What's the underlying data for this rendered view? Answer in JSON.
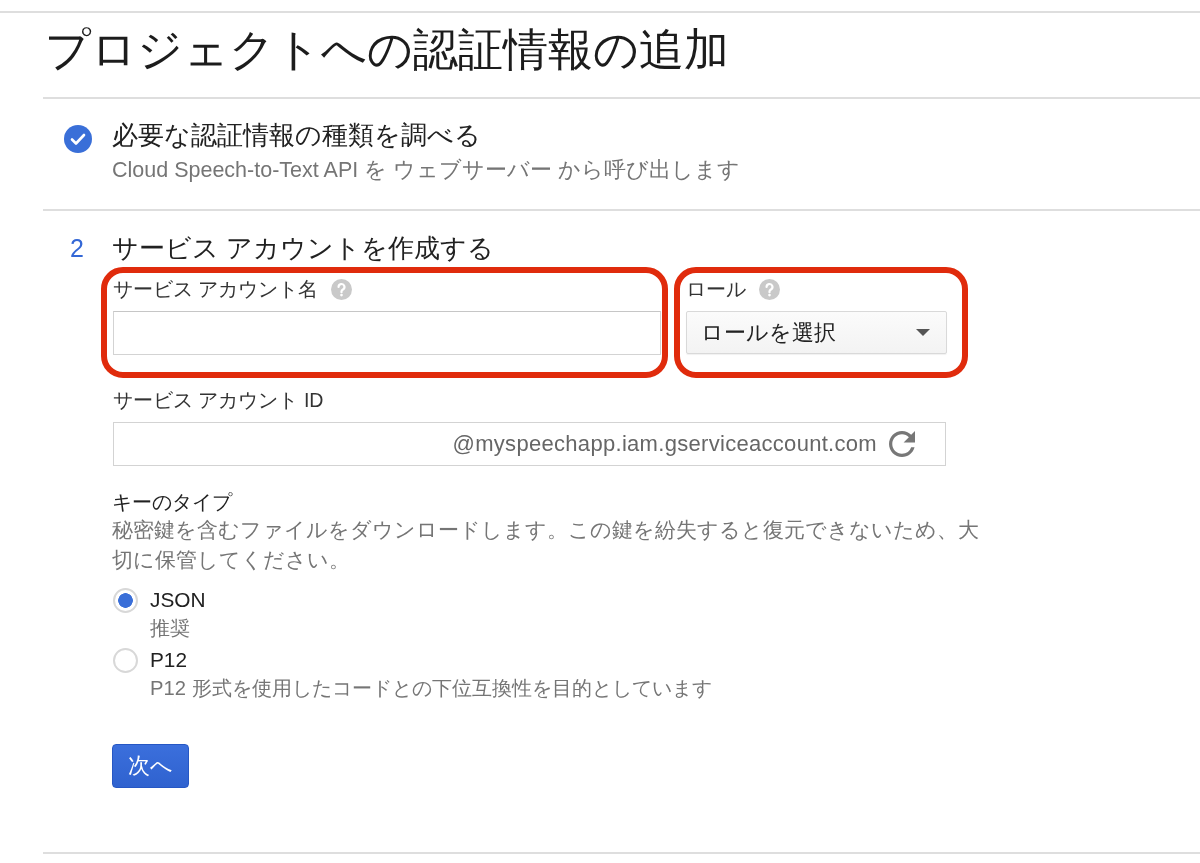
{
  "page_title": "プロジェクトへの認証情報の追加",
  "steps": [
    {
      "kind": "done",
      "title": "必要な認証情報の種類を調べる",
      "description": "Cloud Speech-to-Text API を ウェブサーバー から呼び出します"
    },
    {
      "kind": "numbered",
      "number": "2",
      "title": "サービス アカウントを作成する",
      "fields": [
        {
          "kind": "text",
          "label": "サービス アカウント名",
          "help": true,
          "highlighted": true
        },
        {
          "kind": "select",
          "label": "ロール",
          "help": true,
          "value": "ロールを選択",
          "highlighted": true
        },
        {
          "kind": "suffixed",
          "label": "サービス アカウント ID",
          "help": false,
          "suffix": "@myspeechapp.iam.gserviceaccount.com",
          "highlighted": false
        }
      ],
      "key_type": {
        "label": "キーのタイプ",
        "description": "秘密鍵を含むファイルをダウンロードします。この鍵を紛失すると復元できないため、大切に保管してください。",
        "options": [
          {
            "label": "JSON",
            "note": "推奨",
            "selected": true
          },
          {
            "label": "P12",
            "note": "P12 形式を使用したコードとの下位互換性を目的としています",
            "selected": false
          }
        ]
      },
      "buttons": [
        {
          "kind": "primary",
          "label": "次へ"
        }
      ]
    }
  ]
}
